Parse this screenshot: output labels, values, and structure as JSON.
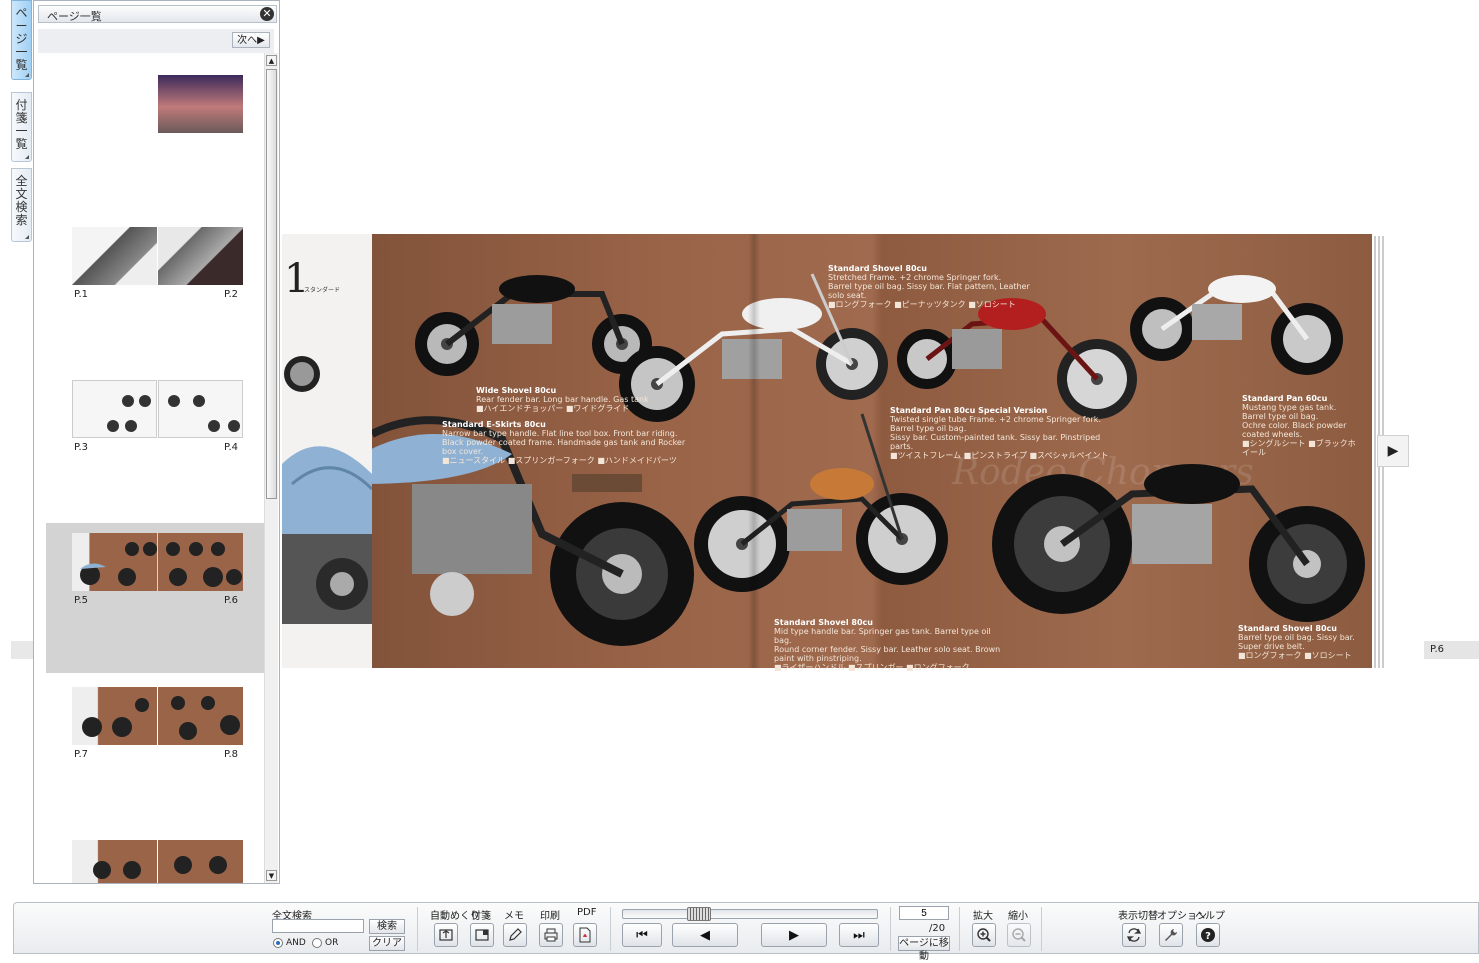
{
  "side_tabs": [
    {
      "label": "ページ一覧"
    },
    {
      "label": "付箋一覧"
    },
    {
      "label": "全文検索"
    }
  ],
  "panel": {
    "title": "ページ一覧",
    "close_label": "✕",
    "next_label": "次へ▶",
    "thumbnails": [
      {
        "left_label": "",
        "right_label": ""
      },
      {
        "left_label": "P.1",
        "right_label": "P.2"
      },
      {
        "left_label": "P.3",
        "right_label": "P.4"
      },
      {
        "left_label": "P.5",
        "right_label": "P.6"
      },
      {
        "left_label": "P.7",
        "right_label": "P.8"
      }
    ]
  },
  "spread": {
    "title_fragment": "1",
    "title_sub": "スタンダード",
    "captions": [
      {
        "title": "Wide Shovel 80cu",
        "lines": [
          "Rear fender bar. Long bar handle. Gas tank",
          "■ハイエンドチョッパー ■ワイドグライド"
        ]
      },
      {
        "title": "Standard E-Skirts 80cu",
        "lines": [
          "Narrow bar type handle. Flat line tool box. Front bar riding.",
          "Black powder coated frame. Handmade gas tank and Rocker box cover.",
          "■ニュースタイル ■スプリンガーフォーク ■ハンドメイドパーツ"
        ]
      },
      {
        "title": "Standard Shovel 80cu",
        "lines": [
          "Stretched Frame. +2 chrome Springer fork.",
          "Barrel type oil bag. Sissy bar. Flat pattern, Leather solo seat.",
          "■ロングフォーク ■ピーナッツタンク ■ソロシート"
        ]
      },
      {
        "title": "Standard Pan 80cu Special Version",
        "lines": [
          "Twisted single tube Frame. +2 chrome Springer fork. Barrel type oil bag.",
          "Sissy bar. Custom-painted tank. Sissy bar. Pinstriped parts.",
          "■ツイストフレーム ■ピンストライプ ■スペシャルペイント"
        ]
      },
      {
        "title": "Standard Pan 60cu",
        "lines": [
          "Mustang type gas tank. Barrel type oil bag.",
          "Ochre color. Black powder coated wheels.",
          "■シングルシート ■ブラックホイール"
        ]
      },
      {
        "title": "Standard Shovel 80cu",
        "lines": [
          "Mid type handle bar. Springer gas tank. Barrel type oil bag.",
          "Round corner fender. Sissy bar. Leather solo seat. Brown paint with pinstriping.",
          "■ライザーハンドル ■スプリンガー ■ロングフォーク"
        ]
      },
      {
        "title": "Standard Shovel 80cu",
        "lines": [
          "Barrel type oil bag. Sissy bar. Super drive belt.",
          "■ロングフォーク ■ソロシート"
        ]
      }
    ],
    "watermark": "Rodeo Choppers",
    "next_page_label": "▶",
    "page_indicator": "P.6"
  },
  "toolbar": {
    "search_label": "全文検索",
    "search_placeholder": "",
    "search_button": "検索",
    "clear_button": "クリア",
    "and_label": "AND",
    "or_label": "OR",
    "auto_flip": "自動めくり",
    "sticky": "付箋",
    "memo": "メモ",
    "print": "印刷",
    "pdf": "PDF",
    "first_label": "⏮",
    "prev_label": "◀",
    "next_label": "▶",
    "last_label": "⏭",
    "slider_position": 0.27,
    "page_input": "5",
    "page_total": "/20",
    "goto_button": "ページに移動",
    "zoom_in": "拡大",
    "zoom_out": "縮小",
    "display_switch": "表示切替",
    "options": "オプション",
    "help": "ヘルプ"
  },
  "colors": {
    "spread_brown": "#9a6448",
    "selected_thumb_bg": "#d3d3d3",
    "active_tab": "#9fd0f4"
  }
}
